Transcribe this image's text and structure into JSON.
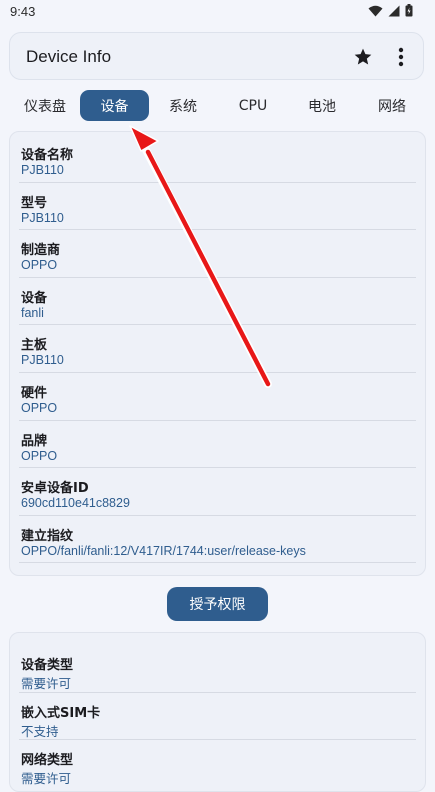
{
  "status_bar": {
    "time": "9:43",
    "icons": [
      "wifi-icon",
      "signal-icon",
      "battery-icon"
    ]
  },
  "app_bar": {
    "title": "Device Info",
    "actions": [
      "star-icon",
      "more-vert-icon"
    ]
  },
  "tabs": [
    {
      "label": "仪表盘",
      "active": false
    },
    {
      "label": "设备",
      "active": true
    },
    {
      "label": "系统",
      "active": false
    },
    {
      "label": "CPU",
      "active": false
    },
    {
      "label": "电池",
      "active": false
    },
    {
      "label": "网络",
      "active": false
    }
  ],
  "device_card": {
    "rows": [
      {
        "label": "设备名称",
        "value": "PJB110"
      },
      {
        "label": "型号",
        "value": "PJB110"
      },
      {
        "label": "制造商",
        "value": "OPPO"
      },
      {
        "label": "设备",
        "value": "fanli"
      },
      {
        "label": "主板",
        "value": "PJB110"
      },
      {
        "label": "硬件",
        "value": "OPPO"
      },
      {
        "label": "品牌",
        "value": "OPPO"
      },
      {
        "label": "安卓设备ID",
        "value": "690cd110e41c8829"
      },
      {
        "label": "建立指纹",
        "value": "OPPO/fanli/fanli:12/V417IR/1744:user/release-keys"
      }
    ]
  },
  "grant_button": {
    "label": "授予权限"
  },
  "permission_card": {
    "rows": [
      {
        "label": "设备类型",
        "value": "需要许可"
      },
      {
        "label": "嵌入式SIM卡",
        "value": "不支持"
      },
      {
        "label": "网络类型",
        "value": "需要许可"
      }
    ]
  },
  "colors": {
    "accent": "#2f5d8e",
    "background": "#f3f5fb",
    "card": "#eef1f8",
    "annotation_arrow": "#e81818"
  }
}
